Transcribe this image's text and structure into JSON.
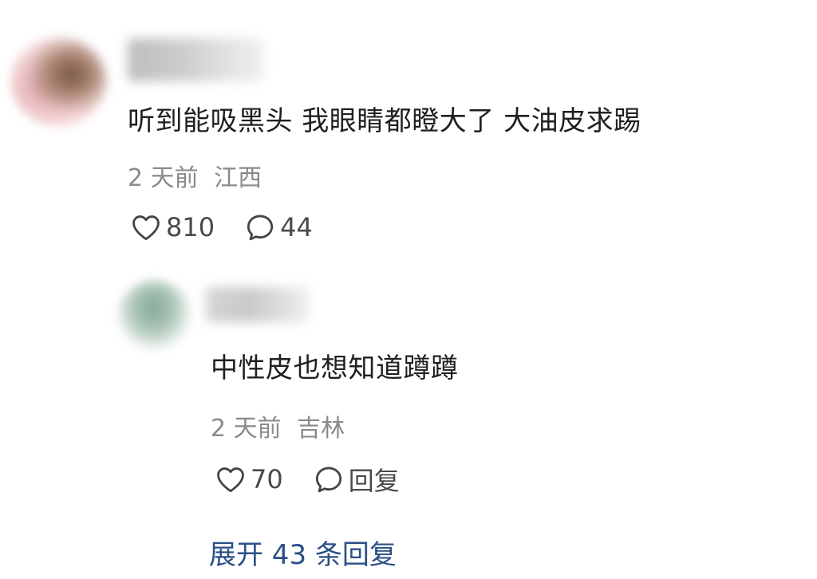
{
  "comment": {
    "text": "听到能吸黑头 我眼睛都瞪大了 大油皮求踢",
    "time": "2 天前",
    "location": "江西",
    "likes": "810",
    "replies_count": "44"
  },
  "reply": {
    "text": "中性皮也想知道蹲蹲",
    "time": "2 天前",
    "location": "吉林",
    "likes": "70",
    "reply_label": "回复"
  },
  "expand": {
    "label": "展开 43 条回复"
  },
  "icons": {
    "like": "heart-outline-icon",
    "comment": "speech-bubble-outline-icon"
  },
  "colors": {
    "text": "#1f1f1f",
    "meta": "#8a8a8a",
    "action": "#4a4a4a",
    "link": "#2b4f87"
  }
}
